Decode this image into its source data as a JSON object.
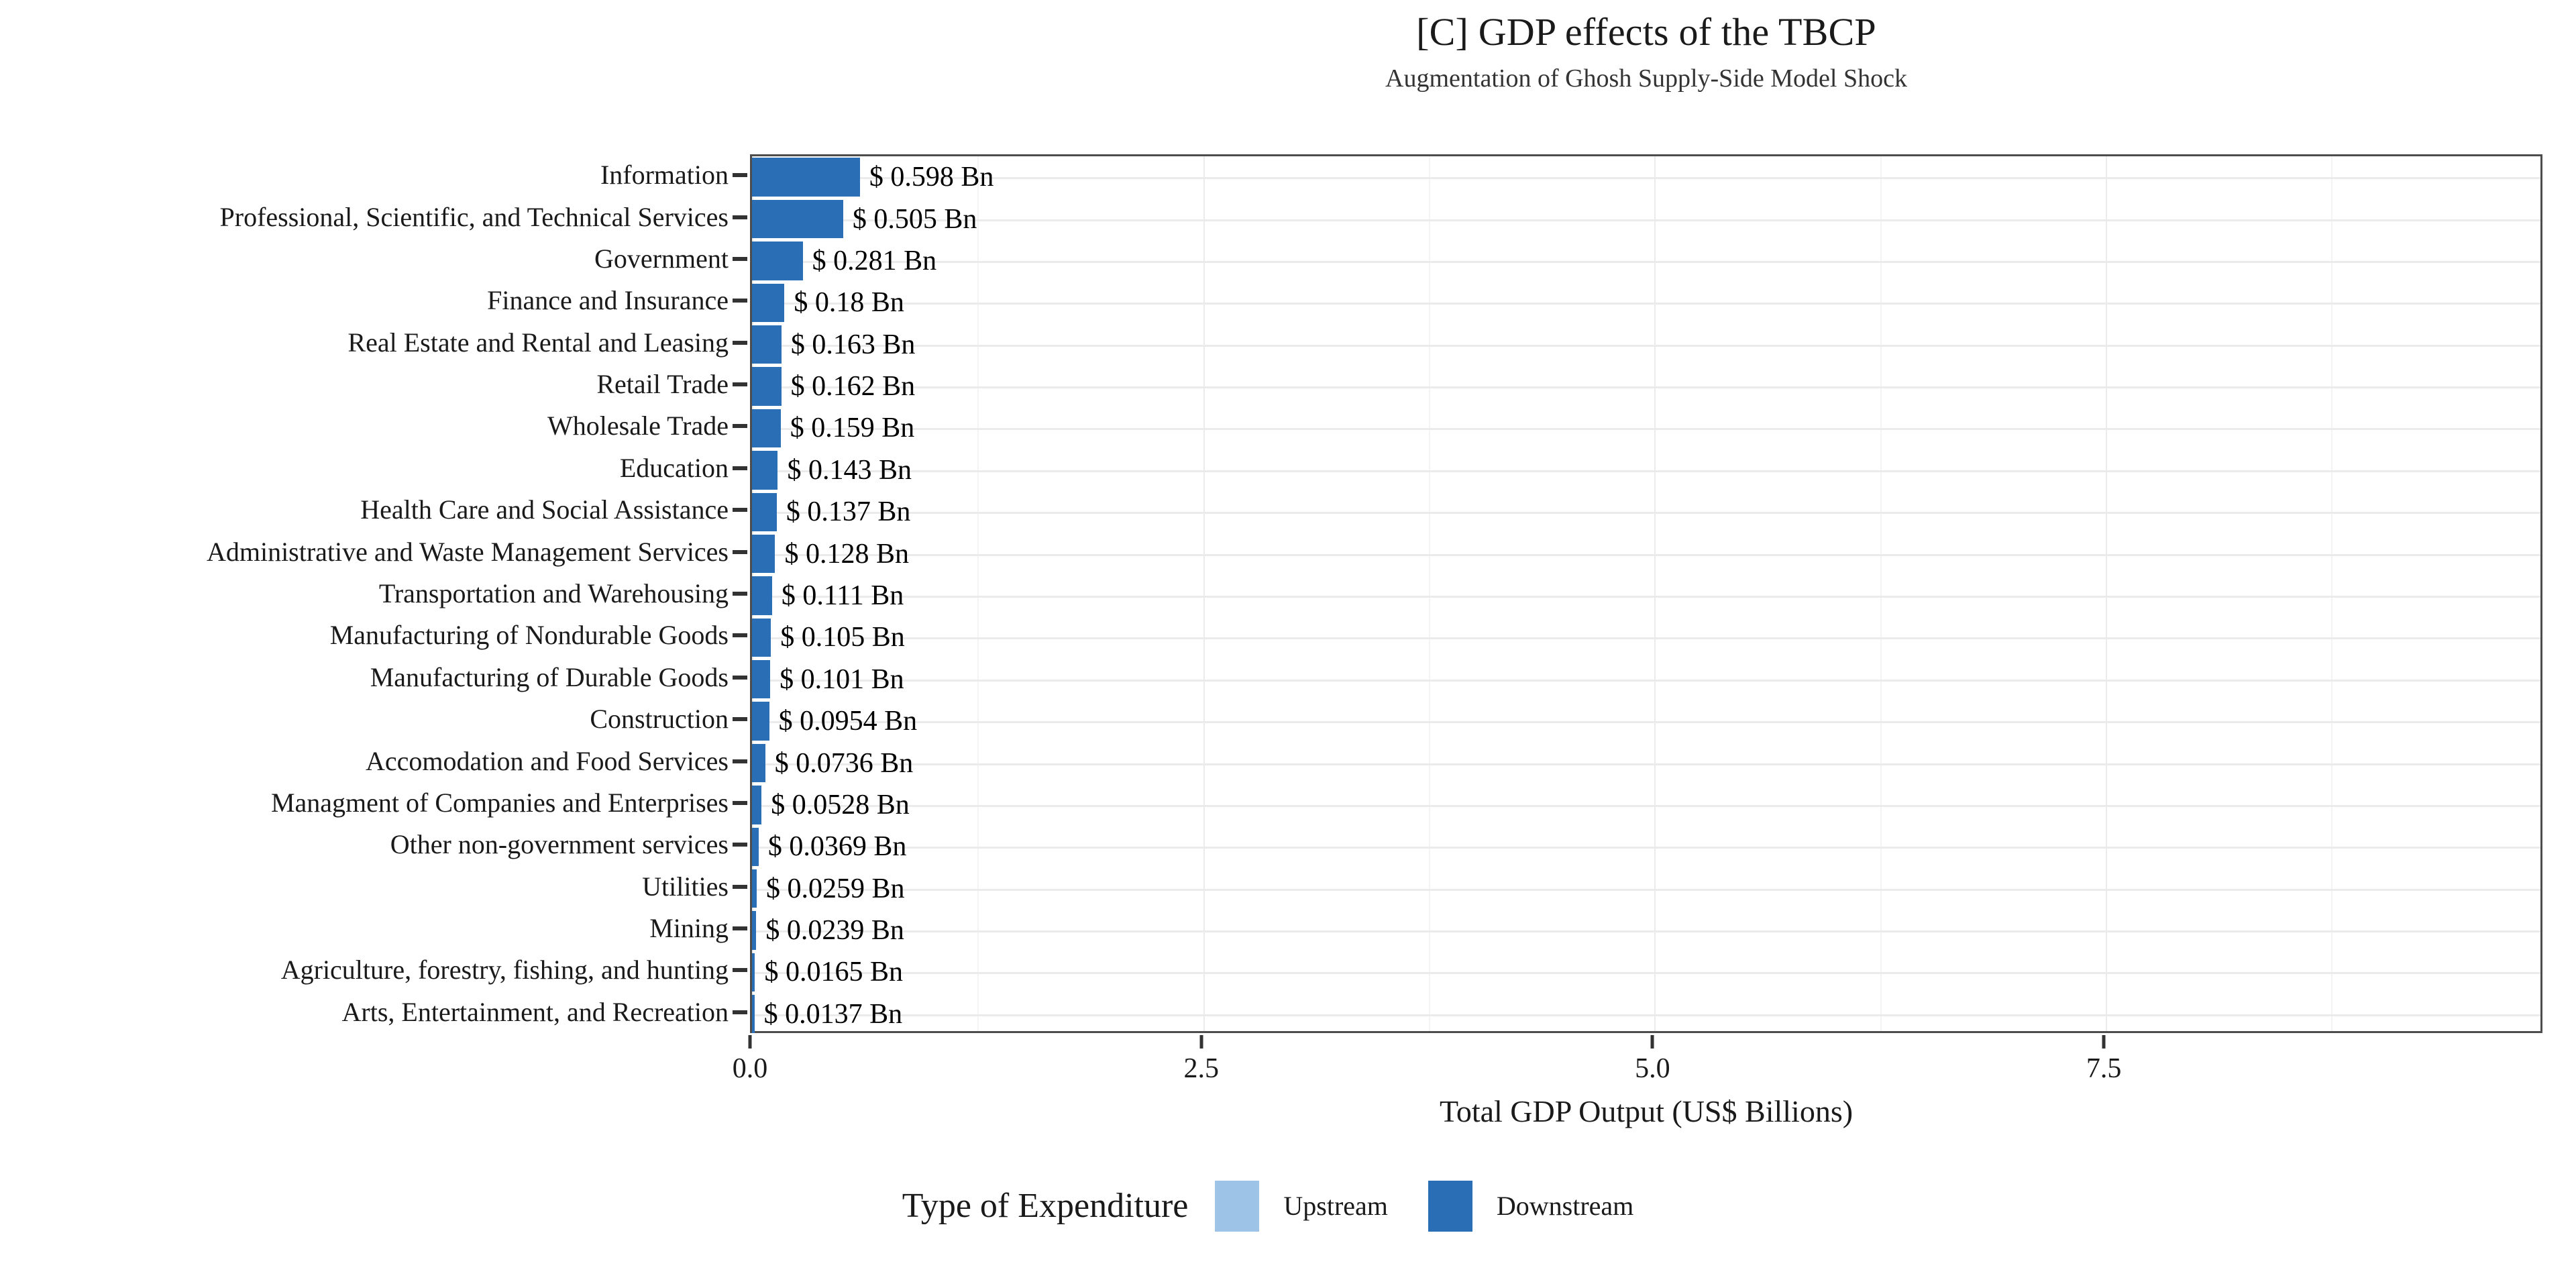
{
  "chart_data": {
    "type": "bar",
    "orientation": "horizontal",
    "stacked": true,
    "title": "[C] GDP effects of the TBCP",
    "subtitle": "Augmentation of Ghosh Supply-Side Model Shock",
    "xlabel": "Total GDP Output (US$ Billions)",
    "ylabel": "",
    "xlim": [
      0,
      9.93
    ],
    "xticks": [
      0.0,
      2.5,
      5.0,
      7.5
    ],
    "xticklabels": [
      "0.0",
      "2.5",
      "5.0",
      "7.5"
    ],
    "grid": true,
    "legend_title": "Type of Expenditure",
    "legend_position": "bottom",
    "series": [
      {
        "name": "Upstream",
        "color": "#9dc3e6",
        "values": [
          0,
          0,
          0,
          0,
          0,
          0,
          0,
          0,
          0,
          0,
          0,
          0,
          0,
          0,
          0,
          0,
          0,
          0,
          0,
          0,
          0
        ]
      },
      {
        "name": "Downstream",
        "color": "#2a6eb5",
        "values": [
          0.598,
          0.505,
          0.281,
          0.18,
          0.163,
          0.162,
          0.159,
          0.143,
          0.137,
          0.128,
          0.111,
          0.105,
          0.101,
          0.0954,
          0.0736,
          0.0528,
          0.0369,
          0.0259,
          0.0239,
          0.0165,
          0.0137
        ]
      }
    ],
    "categories": [
      "Information",
      "Professional, Scientific, and Technical Services",
      "Government",
      "Finance and Insurance",
      "Real Estate and Rental and Leasing",
      "Retail Trade",
      "Wholesale Trade",
      "Education",
      "Health Care and Social Assistance",
      "Administrative and Waste Management Services",
      "Transportation and Warehousing",
      "Manufacturing of Nondurable Goods",
      "Manufacturing of Durable Goods",
      "Construction",
      "Accomodation and Food Services",
      "Managment of Companies and Enterprises",
      "Other non-government services",
      "Utilities",
      "Mining",
      "Agriculture, forestry, fishing, and hunting",
      "Arts, Entertainment, and Recreation"
    ],
    "values": [
      0.598,
      0.505,
      0.281,
      0.18,
      0.163,
      0.162,
      0.159,
      0.143,
      0.137,
      0.128,
      0.111,
      0.105,
      0.101,
      0.0954,
      0.0736,
      0.0528,
      0.0369,
      0.0259,
      0.0239,
      0.0165,
      0.0137
    ],
    "data_labels": [
      "$ 0.598 Bn",
      "$ 0.505 Bn",
      "$ 0.281 Bn",
      "$ 0.18 Bn",
      "$ 0.163 Bn",
      "$ 0.162 Bn",
      "$ 0.159 Bn",
      "$ 0.143 Bn",
      "$ 0.137 Bn",
      "$ 0.128 Bn",
      "$ 0.111 Bn",
      "$ 0.105 Bn",
      "$ 0.101 Bn",
      "$ 0.0954 Bn",
      "$ 0.0736 Bn",
      "$ 0.0528 Bn",
      "$ 0.0369 Bn",
      "$ 0.0259 Bn",
      "$ 0.0239 Bn",
      "$ 0.0165 Bn",
      "$ 0.0137 Bn"
    ]
  },
  "legend": {
    "title": "Type of Expenditure",
    "items": [
      {
        "label": "Upstream",
        "color": "#9dc3e6"
      },
      {
        "label": "Downstream",
        "color": "#2a6eb5"
      }
    ]
  },
  "colors": {
    "upstream": "#9dc3e6",
    "downstream": "#2a6eb5",
    "panel_border": "#4d4d4d",
    "gridline": "#ebebeb",
    "text": "#1a1a1a"
  }
}
